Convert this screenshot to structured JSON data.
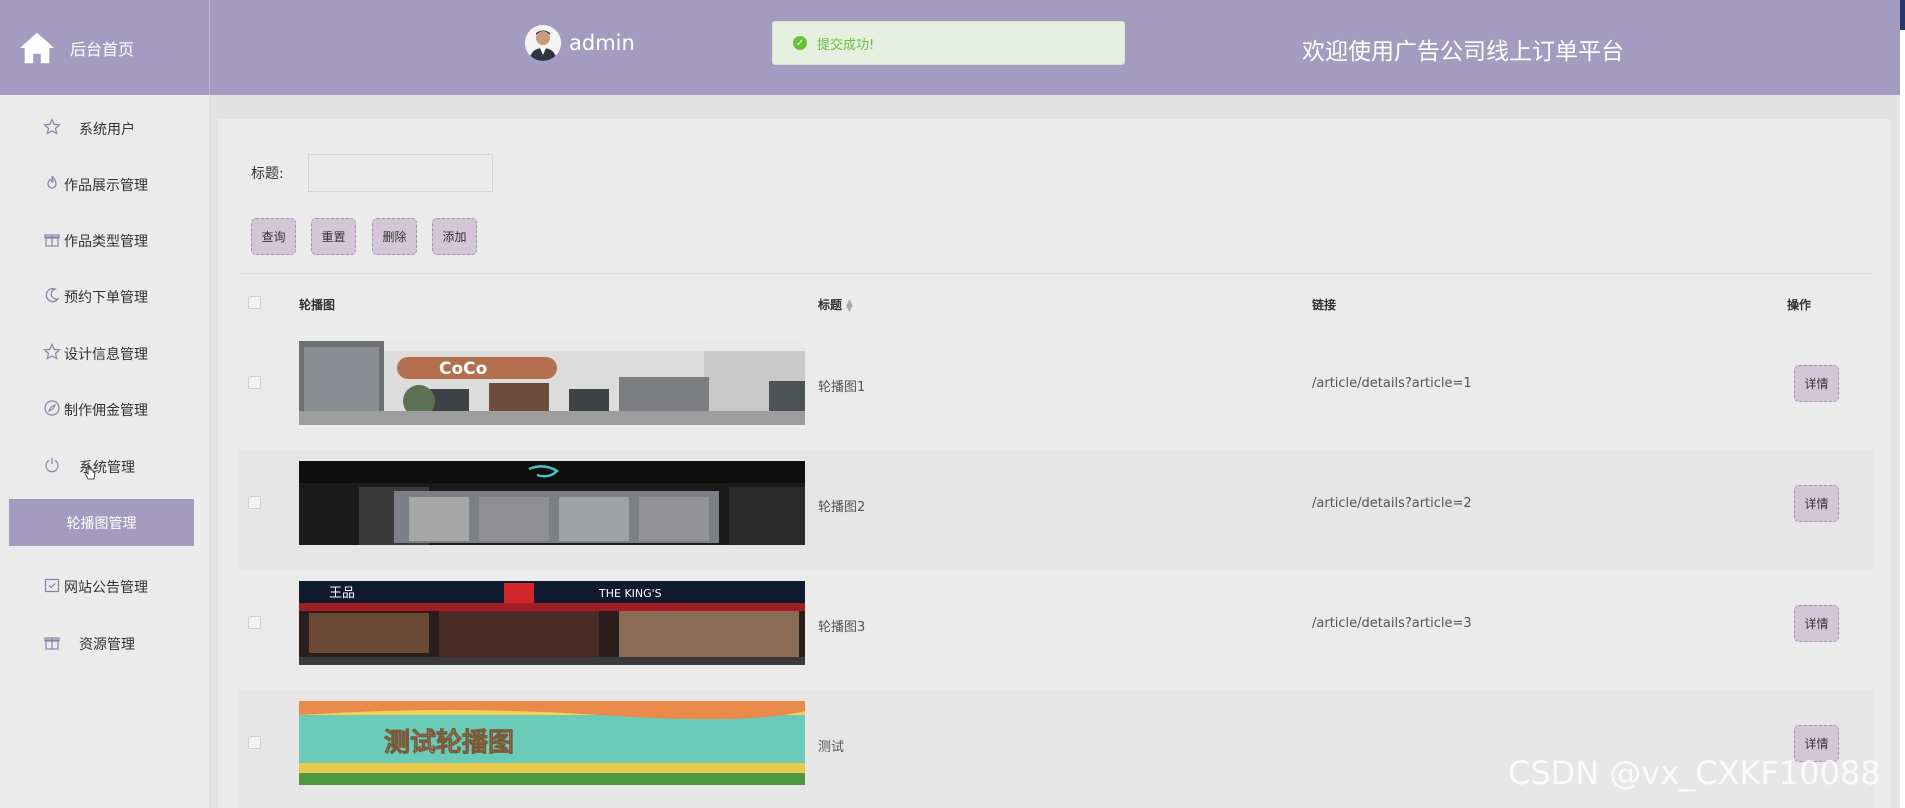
{
  "header": {
    "home_label": "后台首页",
    "user_name": "admin",
    "toast": "提交成功!",
    "welcome": "欢迎使用广告公司线上订单平台"
  },
  "sidebar": {
    "items": [
      {
        "label": "系统用户",
        "icon": "star-icon"
      },
      {
        "label": "作品展示管理",
        "icon": "flame-icon"
      },
      {
        "label": "作品类型管理",
        "icon": "gift-icon"
      },
      {
        "label": "预约下单管理",
        "icon": "moon-icon"
      },
      {
        "label": "设计信息管理",
        "icon": "star-icon"
      },
      {
        "label": "制作佣金管理",
        "icon": "compass-icon"
      },
      {
        "label": "系统管理",
        "icon": "power-icon"
      },
      {
        "label": "网站公告管理",
        "icon": "calendar-check-icon"
      },
      {
        "label": "资源管理",
        "icon": "gift-icon"
      }
    ],
    "active_sub": "轮播图管理"
  },
  "search": {
    "label": "标题:",
    "value": ""
  },
  "toolbar": {
    "query": "查询",
    "reset": "重置",
    "delete": "删除",
    "add": "添加"
  },
  "table": {
    "headers": {
      "image": "轮播图",
      "title": "标题",
      "link": "链接",
      "action": "操作"
    },
    "rows": [
      {
        "title": "轮播图1",
        "link": "/article/details?article=1",
        "action": "详情",
        "image_text": "CoCo"
      },
      {
        "title": "轮播图2",
        "link": "/article/details?article=2",
        "action": "详情",
        "image_text": ""
      },
      {
        "title": "轮播图3",
        "link": "/article/details?article=3",
        "action": "详情",
        "image_text": "THE KING'S"
      },
      {
        "title": "测试",
        "link": "",
        "action": "详情",
        "image_text": "测试轮播图"
      }
    ]
  },
  "watermark": "CSDN @vx_CXKF10088"
}
